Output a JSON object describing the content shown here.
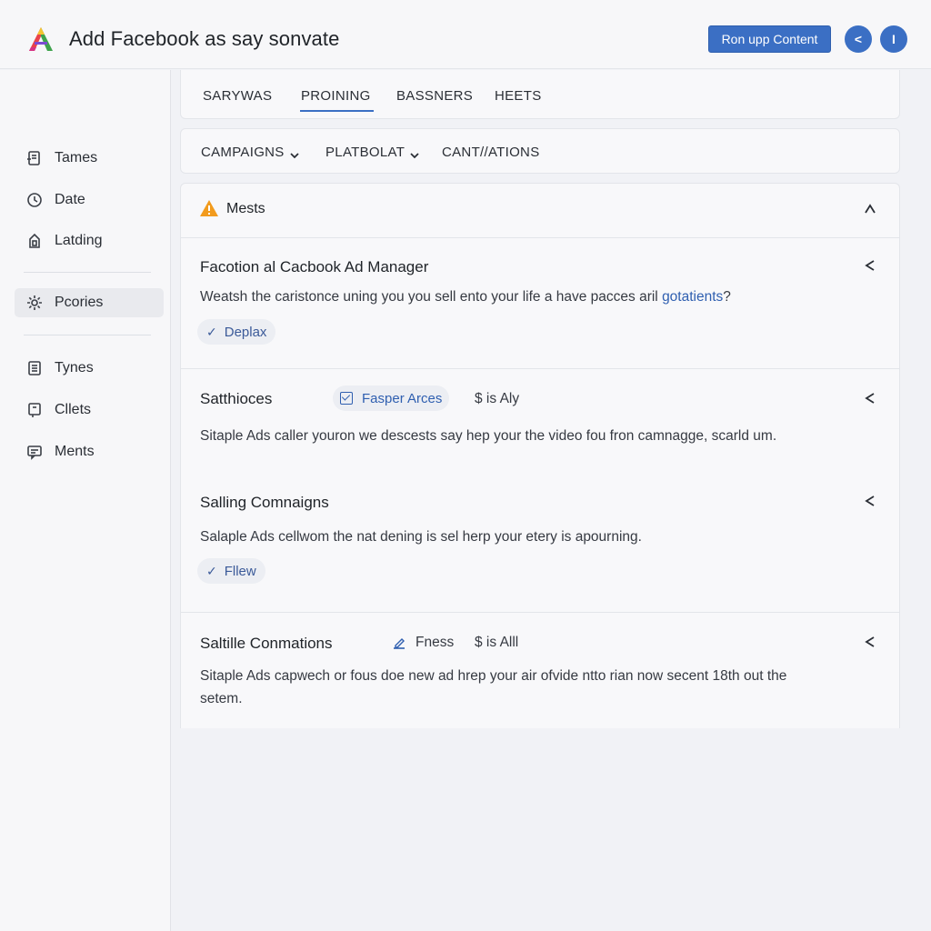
{
  "header": {
    "title": "Add Facebook as say sonvate",
    "primary_button": "Ron upp Content",
    "back_icon": "chevron-left-icon",
    "info_icon": "info-icon",
    "info_glyph": "I",
    "back_glyph": "<"
  },
  "sidebar": {
    "items": [
      {
        "label": "Tames",
        "icon": "document-list-icon"
      },
      {
        "label": "Date",
        "icon": "clock-icon"
      },
      {
        "label": "Latding",
        "icon": "lock-icon"
      },
      {
        "label": "Pcories",
        "icon": "gear-icon",
        "active": true
      },
      {
        "label": "Tynes",
        "icon": "list-icon"
      },
      {
        "label": "Cllets",
        "icon": "page-icon"
      },
      {
        "label": "Ments",
        "icon": "message-icon"
      }
    ]
  },
  "tabs": [
    "SARYWAS",
    "PROINING",
    "BASSNERS",
    "HEETS"
  ],
  "active_tab": "PROINING",
  "filters": [
    "CAMPAIGNS",
    "PLATBOLAT",
    "CANT//ATIONS"
  ],
  "alert": {
    "label": "Mests",
    "color": "#f29b1d"
  },
  "sections": [
    {
      "title": "Facotion al Cacbook Ad Manager",
      "desc_main": "Weatsh the caristonce uning you you sell ento your life a have pacces aril ",
      "desc_link": "gotatients",
      "desc_end": "?",
      "chip": "Deplax"
    },
    {
      "title": "Satthioces",
      "tag": "Fasper Arces",
      "meta": "$ is Aly",
      "desc": "Sitaple Ads caller youron we descests say hep your the video fou fron camnagge, scarld um."
    },
    {
      "title": "Salling Comnaigns",
      "desc": "Salaple Ads cellwom the nat dening is sel herp your etery is apourning.",
      "chip": "Fllew"
    },
    {
      "title": "Saltille Conmations",
      "tag": "Fness",
      "meta": "$ is Alll",
      "desc": "Sitaple Ads capwech or fous doe new ad hrep your air ofvide ntto rian now secent 18th out the setem."
    }
  ],
  "colors": {
    "accent": "#3b6fc4",
    "link": "#2f5fb0",
    "warning": "#f29b1d"
  }
}
